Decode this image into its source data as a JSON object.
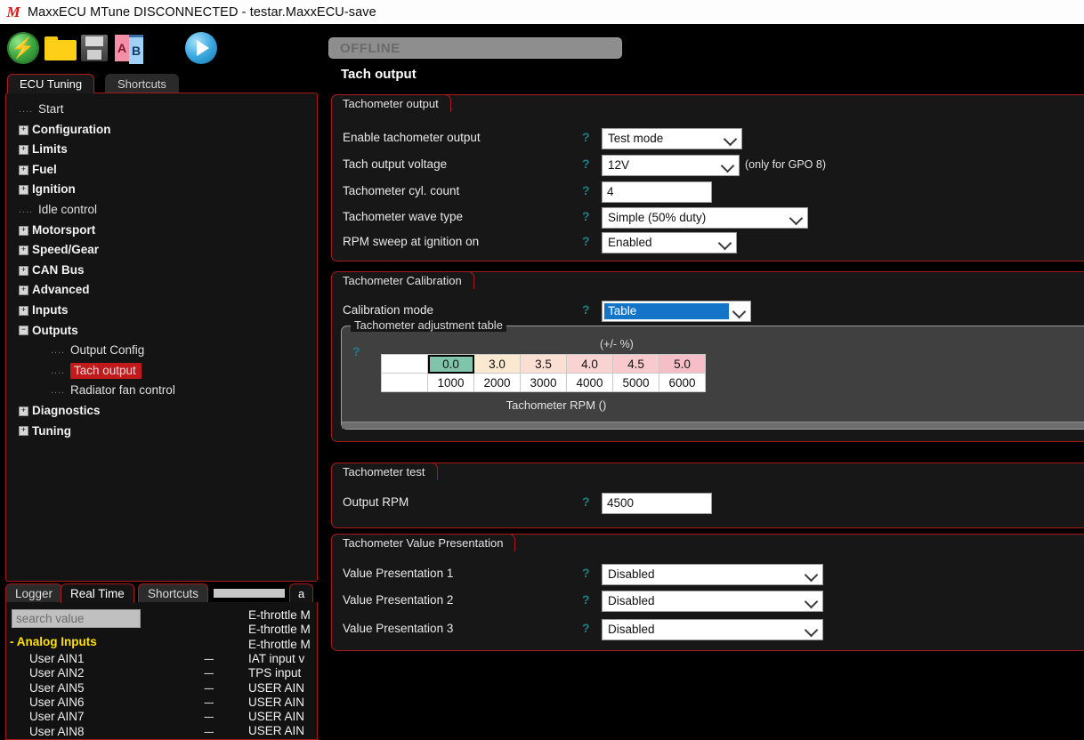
{
  "window": {
    "title": "MaxxECU MTune DISCONNECTED - testar.MaxxECU-save",
    "logo": "M"
  },
  "toolbar": {
    "icons": [
      {
        "name": "connect-icon",
        "label": "Connect"
      },
      {
        "name": "open-file-icon",
        "label": "Open"
      },
      {
        "name": "save-file-icon",
        "label": "Save"
      },
      {
        "name": "compare-ab-icon",
        "label": "Compare A/B"
      },
      {
        "name": "start-icon",
        "label": "Start"
      }
    ]
  },
  "status": {
    "offline_banner": "OFFLINE",
    "page_title": "Tach output"
  },
  "left_tabs": [
    {
      "label": "ECU Tuning",
      "selected": true
    },
    {
      "label": "Shortcuts",
      "selected": false
    }
  ],
  "tree": [
    {
      "label": "Start",
      "kind": "leaf",
      "level": 0
    },
    {
      "label": "Configuration",
      "kind": "expand",
      "level": 0
    },
    {
      "label": "Limits",
      "kind": "expand",
      "level": 0
    },
    {
      "label": "Fuel",
      "kind": "expand",
      "level": 0
    },
    {
      "label": "Ignition",
      "kind": "expand",
      "level": 0
    },
    {
      "label": "Idle control",
      "kind": "leaf",
      "level": 0
    },
    {
      "label": "Motorsport",
      "kind": "expand",
      "level": 0
    },
    {
      "label": "Speed/Gear",
      "kind": "expand",
      "level": 0
    },
    {
      "label": "CAN Bus",
      "kind": "expand",
      "level": 0
    },
    {
      "label": "Advanced",
      "kind": "expand",
      "level": 0
    },
    {
      "label": "Inputs",
      "kind": "expand",
      "level": 0
    },
    {
      "label": "Outputs",
      "kind": "collapse",
      "level": 0
    },
    {
      "label": "Output Config",
      "kind": "leaf",
      "level": 1
    },
    {
      "label": "Tach output",
      "kind": "leaf",
      "level": 1,
      "selected": true
    },
    {
      "label": "Radiator fan control",
      "kind": "leaf",
      "level": 1
    },
    {
      "label": "Diagnostics",
      "kind": "expand",
      "level": 0
    },
    {
      "label": "Tuning",
      "kind": "expand",
      "level": 0
    }
  ],
  "groups": {
    "tach_output": {
      "title": "Tachometer output",
      "rows": [
        {
          "label": "Enable tachometer output",
          "value": "Test mode",
          "type": "select"
        },
        {
          "label": "Tach output voltage",
          "value": "12V",
          "type": "select",
          "note": "(only for GPO 8)"
        },
        {
          "label": "Tachometer cyl. count",
          "value": "4",
          "type": "text"
        },
        {
          "label": "Tachometer wave type",
          "value": "Simple (50% duty)",
          "type": "select"
        },
        {
          "label": "RPM sweep at ignition on",
          "value": "Enabled",
          "type": "select"
        }
      ]
    },
    "tach_calibration": {
      "title": "Tachometer Calibration",
      "mode_label": "Calibration mode",
      "mode_value": "Table",
      "table_group_title": "Tachometer adjustment table",
      "unit_label": "(+/- %)",
      "axis_title": "Tachometer RPM ()"
    },
    "tach_test": {
      "title": "Tachometer test",
      "rows": [
        {
          "label": "Output RPM",
          "value": "4500",
          "type": "text"
        }
      ]
    },
    "tach_value_presentation": {
      "title": "Tachometer Value Presentation",
      "rows": [
        {
          "label": "Value Presentation 1",
          "value": "Disabled",
          "type": "select"
        },
        {
          "label": "Value Presentation 2",
          "value": "Disabled",
          "type": "select"
        },
        {
          "label": "Value Presentation 3",
          "value": "Disabled",
          "type": "select"
        }
      ]
    }
  },
  "chart_data": {
    "type": "table",
    "title": "Tachometer adjustment table",
    "xlabel": "Tachometer RPM ()",
    "ylabel": "(+/- %)",
    "categories": [
      "1000",
      "2000",
      "3000",
      "4000",
      "5000",
      "6000"
    ],
    "values": [
      "0.0",
      "3.0",
      "3.5",
      "4.0",
      "4.5",
      "5.0"
    ],
    "cell_colors": [
      "#7fc4ab",
      "#fae8d0",
      "#fbdfd3",
      "#f9d3d1",
      "#f8c9cd",
      "#f6bfc8"
    ],
    "selected_index": 0
  },
  "bottom": {
    "tabs": [
      {
        "label": "Logger",
        "selected": false
      },
      {
        "label": "Real Time",
        "selected": true
      },
      {
        "label": "Shortcuts",
        "selected": false
      }
    ],
    "extra_tab": "a",
    "search_placeholder": "search value",
    "group_header": "- Analog Inputs",
    "rows": [
      {
        "name": "User AIN1",
        "value": "---"
      },
      {
        "name": "User AIN2",
        "value": "---"
      },
      {
        "name": "User AIN5",
        "value": "---"
      },
      {
        "name": "User AIN6",
        "value": "---"
      },
      {
        "name": "User AIN7",
        "value": "---"
      },
      {
        "name": "User AIN8",
        "value": "---"
      }
    ],
    "right_rows": [
      "E-throttle M",
      "E-throttle M",
      "E-throttle M",
      "IAT input v",
      "TPS input ",
      "USER AIN",
      "USER AIN",
      "USER AIN",
      "USER AIN"
    ]
  },
  "colors": {
    "accent_red": "#a81a1a",
    "selected_red": "#c2191b",
    "help_teal": "#1f7f86",
    "highlight_blue": "#1474c8",
    "group_header_yellow": "#ffe000"
  }
}
